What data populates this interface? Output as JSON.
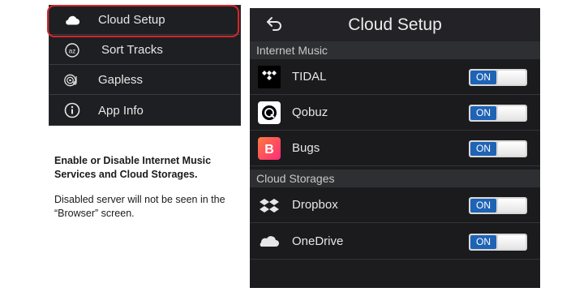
{
  "menu": {
    "items": [
      {
        "label": "Cloud Setup",
        "icon": "cloud-icon"
      },
      {
        "label": "Sort Tracks",
        "icon": "sort-icon"
      },
      {
        "label": "Gapless",
        "icon": "gapless-icon"
      },
      {
        "label": "App Info",
        "icon": "info-icon"
      }
    ],
    "highlighted": "Cloud Setup"
  },
  "caption": {
    "title": "Enable or Disable Internet Music Services and Cloud Storages.",
    "note": "Disabled server will not be seen in the “Browser” screen."
  },
  "screen": {
    "title": "Cloud Setup",
    "sections": [
      {
        "title": "Internet Music",
        "items": [
          {
            "label": "TIDAL",
            "toggle": "ON",
            "icon": "tidal-icon"
          },
          {
            "label": "Qobuz",
            "toggle": "ON",
            "icon": "qobuz-icon"
          },
          {
            "label": "Bugs",
            "toggle": "ON",
            "icon": "bugs-icon"
          }
        ]
      },
      {
        "title": "Cloud Storages",
        "items": [
          {
            "label": "Dropbox",
            "toggle": "ON",
            "icon": "dropbox-icon"
          },
          {
            "label": "OneDrive",
            "toggle": "ON",
            "icon": "onedrive-icon"
          }
        ]
      }
    ]
  },
  "colors": {
    "highlight": "#d8262b",
    "toggle_on": "#1f63b5",
    "bugs_brand": "#ff3d6e"
  }
}
